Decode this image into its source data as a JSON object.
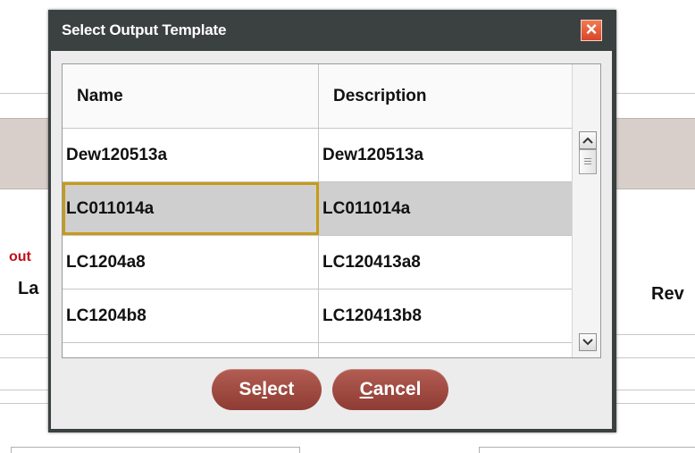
{
  "background": {
    "red_text": "out",
    "left_label": "La",
    "right_label": "Rev"
  },
  "dialog": {
    "title": "Select Output Template",
    "close_icon": "close-x-icon",
    "columns": [
      "Name",
      "Description"
    ],
    "rows": [
      {
        "name": "Dew120513a",
        "description": "Dew120513a"
      },
      {
        "name": "LC011014a",
        "description": "LC011014a",
        "selected": true
      },
      {
        "name": "LC1204a8",
        "description": "LC120413a8"
      },
      {
        "name": "LC1204b8",
        "description": "LC120413b8"
      },
      {
        "name": "",
        "description": ""
      }
    ],
    "scroll_up_icon": "chevron-up-icon",
    "scroll_down_icon": "chevron-down-icon",
    "buttons": {
      "select": {
        "before": "Se",
        "mnemonic": "l",
        "after": "ect"
      },
      "cancel": {
        "before": "",
        "mnemonic": "C",
        "after": "ancel"
      }
    }
  },
  "colors": {
    "title_bar": "#3b4040",
    "button": "#a34c43",
    "close_button": "#e2583a",
    "selected_row": "#cfcfcf",
    "focus_outline": "#c79a16"
  }
}
